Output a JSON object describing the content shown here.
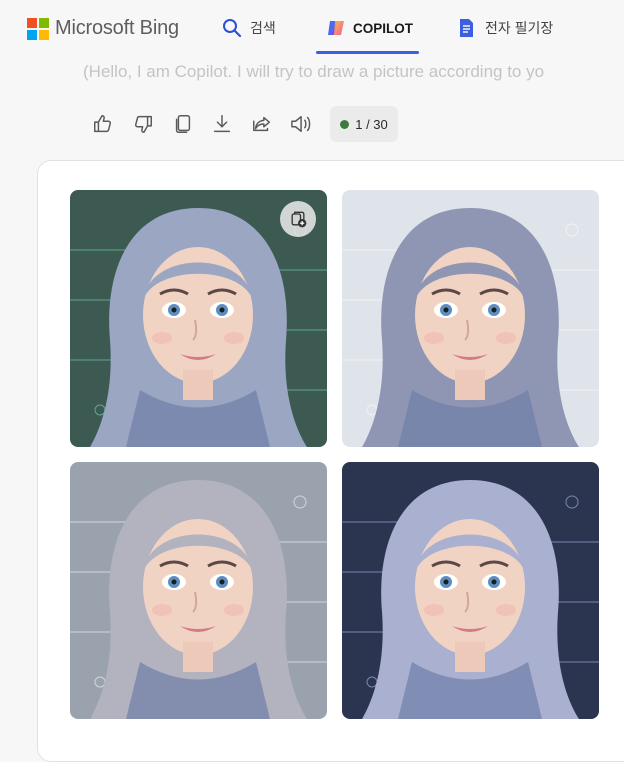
{
  "header": {
    "logo_text": "Microsoft Bing",
    "nav": [
      {
        "label": "검색",
        "icon": "search-icon",
        "active": false
      },
      {
        "label": "COPILOT",
        "icon": "copilot-icon",
        "active": true
      },
      {
        "label": "전자 필기장",
        "icon": "notebook-icon",
        "active": false
      }
    ],
    "accent_color": "#3b5fe0"
  },
  "message": {
    "faded_text": "(Hello, I am Copilot. I will try to draw a picture according to yo"
  },
  "toolbar": {
    "actions": [
      "thumbs-up-icon",
      "thumbs-down-icon",
      "copy-icon",
      "download-icon",
      "share-icon",
      "read-aloud-icon"
    ],
    "counter": "1 / 30",
    "status_color": "#3d7a3d"
  },
  "images": [
    {
      "name": "generated-image-1",
      "hair": "#9aa6c2",
      "bg": "#3c5a52",
      "overlay": "#7fe6c8"
    },
    {
      "name": "generated-image-2",
      "hair": "#8f96b3",
      "bg": "#dfe3ea",
      "overlay": "#ffffff"
    },
    {
      "name": "generated-image-3",
      "hair": "#b3b3c0",
      "bg": "#9aa3ad",
      "overlay": "#ffffff"
    },
    {
      "name": "generated-image-4",
      "hair": "#a9b0d0",
      "bg": "#2c3550",
      "overlay": "#b8c8ff"
    }
  ]
}
